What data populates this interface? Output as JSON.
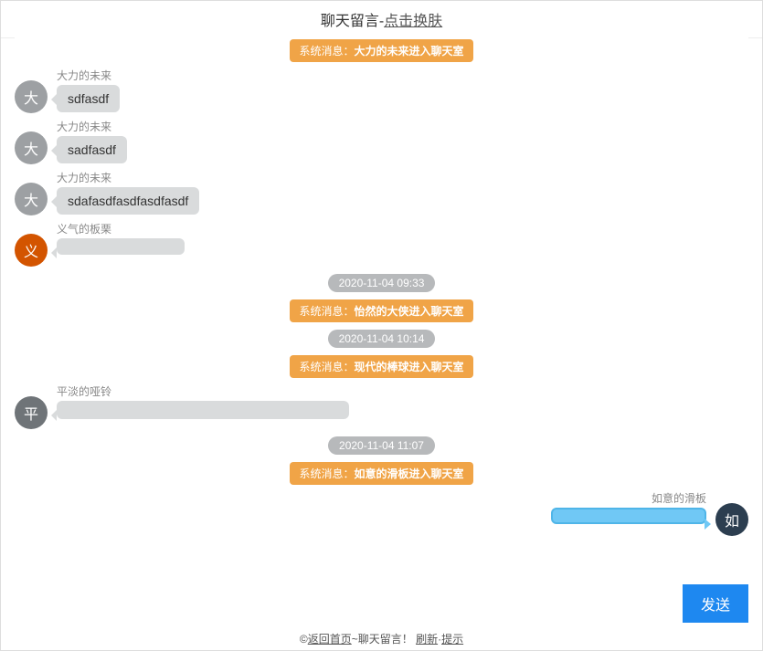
{
  "header": {
    "title": "聊天留言-",
    "link": "点击换肤"
  },
  "colors": {
    "avatar_grey": "#9da0a3",
    "avatar_orange": "#d35400",
    "avatar_dark": "#34495e",
    "avatar_darkblue": "#2c3e50"
  },
  "items": [
    {
      "type": "system",
      "prefix": "系统消息：",
      "bold": "大力的未来进入聊天室"
    },
    {
      "type": "msg",
      "side": "left",
      "avatar_char": "大",
      "avatar_color": "#9da0a3",
      "name": "大力的未来",
      "text": "sdfasdf",
      "bubble": "grey"
    },
    {
      "type": "msg",
      "side": "left",
      "avatar_char": "大",
      "avatar_color": "#9da0a3",
      "name": "大力的未来",
      "text": "sadfasdf",
      "bubble": "grey"
    },
    {
      "type": "msg",
      "side": "left",
      "avatar_char": "大",
      "avatar_color": "#9da0a3",
      "name": "大力的未来",
      "text": "sdafasdfasdfasdfasdf",
      "bubble": "grey"
    },
    {
      "type": "msg",
      "side": "left",
      "avatar_char": "义",
      "avatar_color": "#d35400",
      "name": "义气的板栗",
      "text": "",
      "bubble": "grey",
      "empty": true
    },
    {
      "type": "time",
      "text": "2020-11-04 09:33"
    },
    {
      "type": "system",
      "prefix": "系统消息：",
      "bold": "怡然的大侠进入聊天室"
    },
    {
      "type": "time",
      "text": "2020-11-04 10:14"
    },
    {
      "type": "system",
      "prefix": "系统消息：",
      "bold": "现代的棒球进入聊天室"
    },
    {
      "type": "msg",
      "side": "left",
      "avatar_char": "平",
      "avatar_color": "#6f7478",
      "name": "平淡的哑铃",
      "text": "",
      "bubble": "grey",
      "faded": true
    },
    {
      "type": "time",
      "text": "2020-11-04 11:07"
    },
    {
      "type": "system",
      "prefix": "系统消息：",
      "bold": "如意的滑板进入聊天室"
    },
    {
      "type": "msg",
      "side": "right",
      "avatar_char": "如",
      "avatar_color": "#2c3e50",
      "name": "如意的滑板",
      "text": "",
      "bubble": "blue",
      "empty_blue": true
    }
  ],
  "input": {
    "placeholder": "",
    "send": "发送"
  },
  "footer": {
    "copy": "©",
    "back": "返回首页",
    "sep1": "~",
    "title2": "聊天留言！",
    "refresh": "刷新",
    "sep2": "·",
    "tip": "提示"
  }
}
